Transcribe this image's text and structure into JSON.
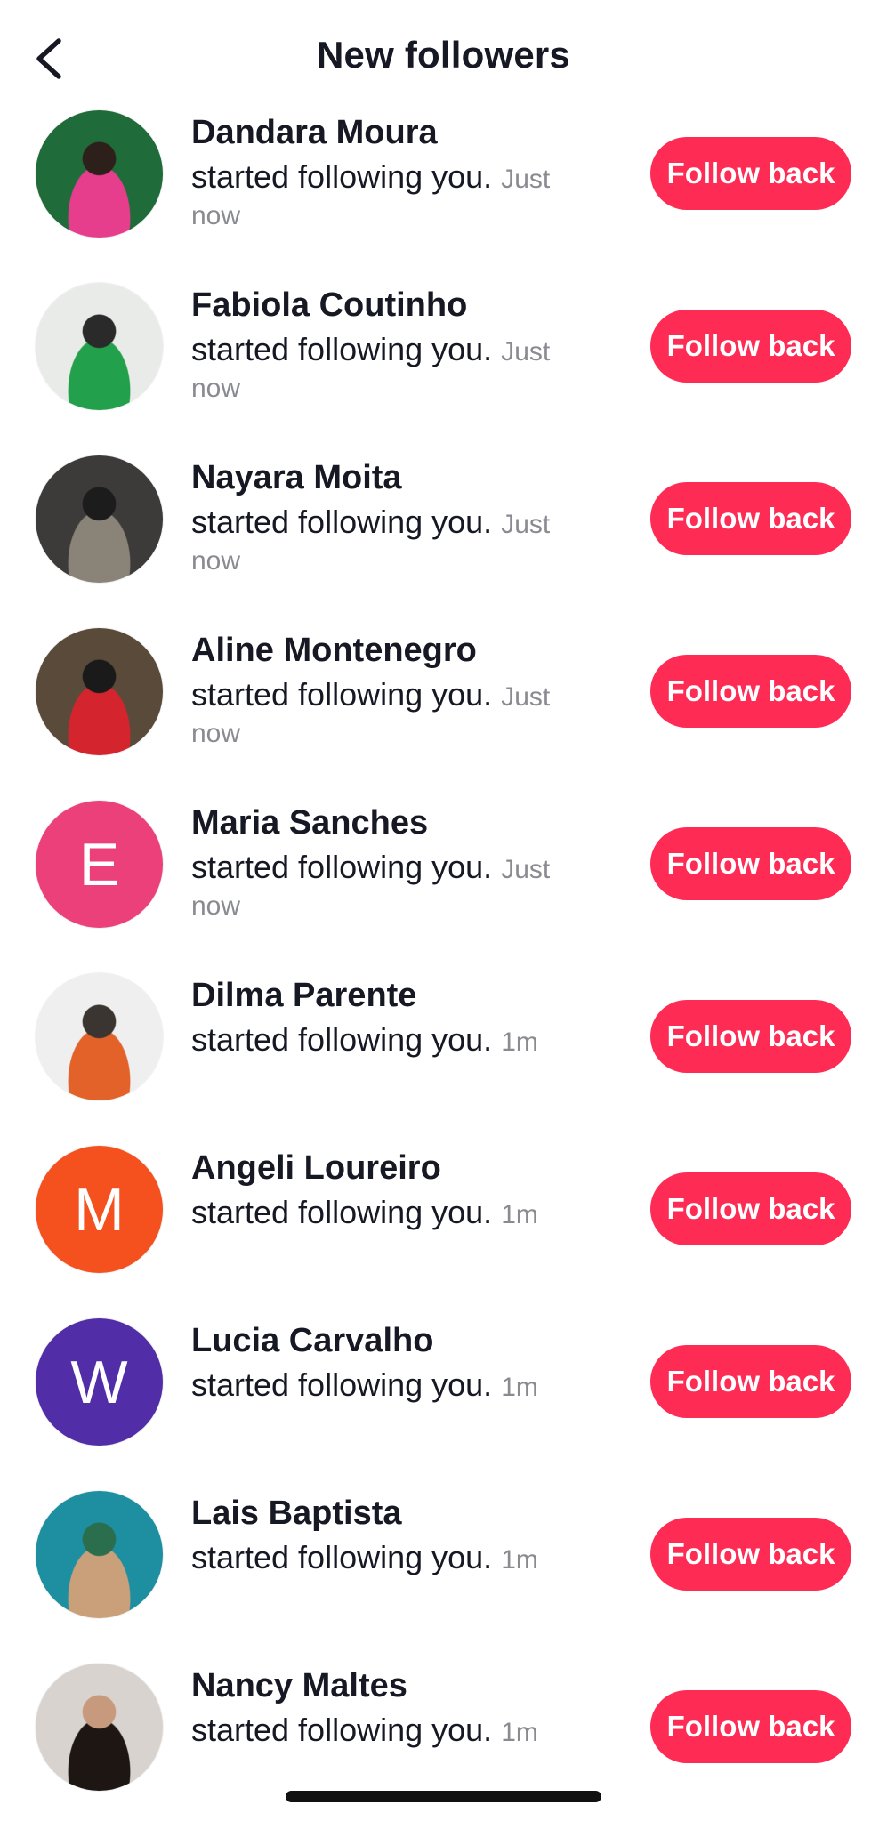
{
  "header": {
    "title": "New followers",
    "back_icon": "chevron-left-icon"
  },
  "follow_label": "Follow back",
  "colors": {
    "accent": "#fe2c55",
    "muted": "#8a8b91",
    "text": "#161823"
  },
  "followers": [
    {
      "name": "Dandara Moura",
      "action": "started following you.",
      "time": "Just now",
      "avatar": {
        "type": "photo",
        "colors": [
          "#1f6b3a",
          "#e63e8c",
          "#2d1f1a"
        ]
      }
    },
    {
      "name": "Fabiola Coutinho",
      "action": "started following you.",
      "time": "Just now",
      "avatar": {
        "type": "photo",
        "colors": [
          "#e9ebe9",
          "#23a04b",
          "#2a2a2a"
        ]
      }
    },
    {
      "name": "Nayara Moita",
      "action": "started following you.",
      "time": "Just now",
      "avatar": {
        "type": "photo",
        "colors": [
          "#3d3a3a",
          "#8a8378",
          "#1c1c1c"
        ]
      }
    },
    {
      "name": "Aline Montenegro",
      "action": "started following you.",
      "time": "Just now",
      "avatar": {
        "type": "photo",
        "colors": [
          "#5a4a3a",
          "#d4252f",
          "#1a1a1a"
        ]
      }
    },
    {
      "name": "Maria Sanches",
      "action": "started following you.",
      "time": "Just now",
      "avatar": {
        "type": "letter",
        "letter": "E",
        "bg": "#ec407a"
      }
    },
    {
      "name": "Dilma Parente",
      "action": "started following you.",
      "time": "1m",
      "avatar": {
        "type": "photo",
        "colors": [
          "#efefef",
          "#e2622a",
          "#3a3530"
        ]
      }
    },
    {
      "name": "Angeli Loureiro",
      "action": "started following you.",
      "time": "1m",
      "avatar": {
        "type": "letter",
        "letter": "M",
        "bg": "#f4511e"
      }
    },
    {
      "name": "Lucia Carvalho",
      "action": "started following you.",
      "time": "1m",
      "avatar": {
        "type": "letter",
        "letter": "W",
        "bg": "#512da8"
      }
    },
    {
      "name": "Lais Baptista",
      "action": "started following you.",
      "time": "1m",
      "avatar": {
        "type": "photo",
        "colors": [
          "#1e8fa0",
          "#c9a07a",
          "#2b6e4e"
        ]
      }
    },
    {
      "name": "Nancy Maltes",
      "action": "started following you.",
      "time": "1m",
      "avatar": {
        "type": "photo",
        "colors": [
          "#d9d3cf",
          "#1d1613",
          "#c79a7d"
        ]
      }
    }
  ]
}
